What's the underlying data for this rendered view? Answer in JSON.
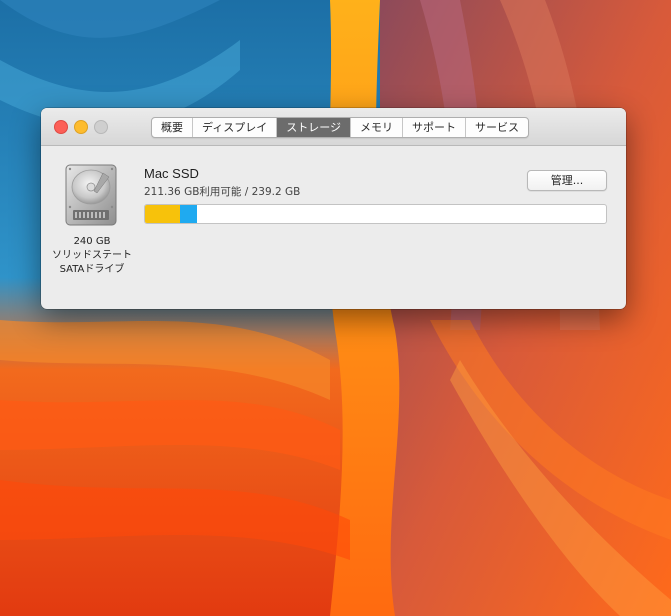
{
  "window": {
    "tabs": [
      {
        "label": "概要",
        "active": false
      },
      {
        "label": "ディスプレイ",
        "active": false
      },
      {
        "label": "ストレージ",
        "active": true
      },
      {
        "label": "メモリ",
        "active": false
      },
      {
        "label": "サポート",
        "active": false
      },
      {
        "label": "サービス",
        "active": false
      }
    ]
  },
  "drive": {
    "icon": "hard-drive-icon",
    "capacity": "240 GB",
    "type_line1": "ソリッドステート",
    "type_line2": "SATAドライブ"
  },
  "volume": {
    "name": "Mac SSD",
    "availability": "211.36 GB利用可能 / 239.2 GB",
    "manage_label": "管理...",
    "total_gb": 239.2,
    "segments": [
      {
        "fraction": 0.075,
        "color": "#f7c20b"
      },
      {
        "fraction": 0.038,
        "color": "#1faaf0"
      }
    ]
  },
  "colors": {
    "close": "#fc5f57",
    "minimize": "#fdbc2e",
    "zoom_disabled": "#cfcfcf",
    "active_tab": "#6c6c6c"
  }
}
